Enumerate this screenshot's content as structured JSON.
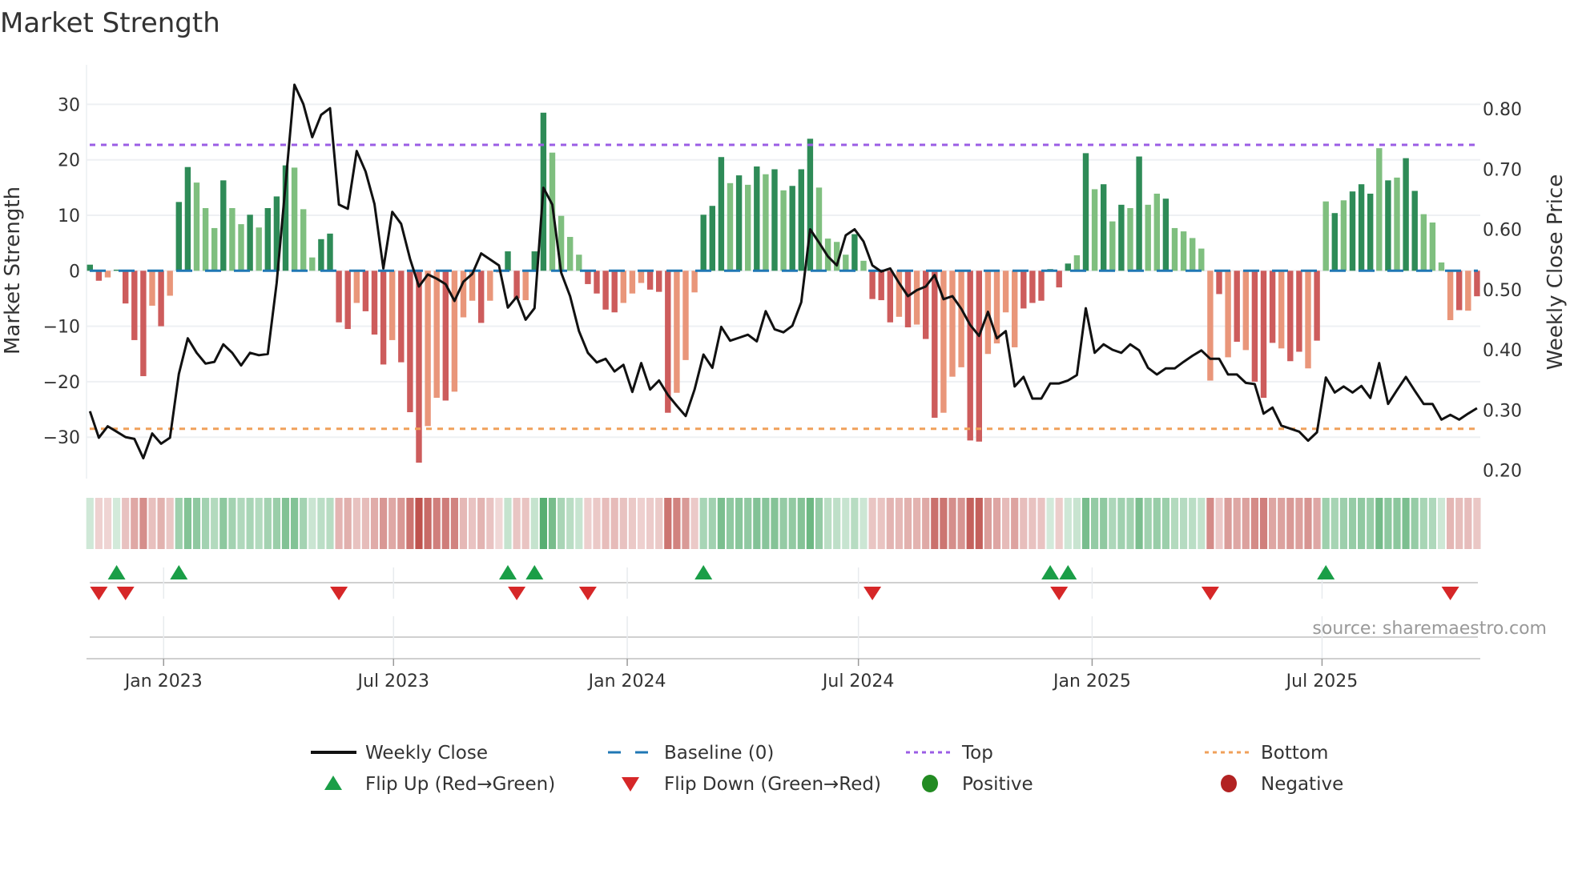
{
  "title": "Market Strength",
  "source": "source: sharemaestro.com",
  "colors": {
    "pos_strong": "#2e8b57",
    "pos_weak": "#7fbf7f",
    "neg_strong": "#cd5c5c",
    "neg_weak": "#e9967a",
    "heat_pos": "#3ca05a",
    "heat_neg": "#be504b",
    "close": "#111111",
    "baseline": "#1f77b4",
    "top": "#9b5de5",
    "bottom": "#f0a05a",
    "flip_up": "#1a9e47",
    "flip_down": "#d62728",
    "positive": "#228b22",
    "negative": "#b22222"
  },
  "chart_data": {
    "type": "bar",
    "title": "Market Strength",
    "ylabel": "Market Strength",
    "y2label": "Weekly Close Price",
    "ylim": [
      -37.5,
      37.1
    ],
    "y2lim": [
      0.186,
      0.873
    ],
    "yticks": [
      {
        "v": 30,
        "label": "30"
      },
      {
        "v": 20,
        "label": "20"
      },
      {
        "v": 10,
        "label": "10"
      },
      {
        "v": 0,
        "label": "0"
      },
      {
        "v": -10,
        "label": "−10"
      },
      {
        "v": -20,
        "label": "−20"
      },
      {
        "v": -30,
        "label": "−30"
      }
    ],
    "y2ticks": [
      {
        "v": 0.8,
        "label": "0.80"
      },
      {
        "v": 0.7,
        "label": "0.70"
      },
      {
        "v": 0.6,
        "label": "0.60"
      },
      {
        "v": 0.5,
        "label": "0.50"
      },
      {
        "v": 0.4,
        "label": "0.40"
      },
      {
        "v": 0.3,
        "label": "0.30"
      },
      {
        "v": 0.2,
        "label": "0.20"
      }
    ],
    "xticks": [
      {
        "date": "2023-01-01",
        "label": "Jan 2023"
      },
      {
        "date": "2023-07-01",
        "label": "Jul 2023"
      },
      {
        "date": "2024-01-01",
        "label": "Jan 2024"
      },
      {
        "date": "2024-07-01",
        "label": "Jul 2024"
      },
      {
        "date": "2025-01-01",
        "label": "Jan 2025"
      },
      {
        "date": "2025-07-01",
        "label": "Jul 2025"
      }
    ],
    "x_start": "2022-11-04",
    "x_freq": "weekly",
    "top_level": 22.7,
    "bottom_level": -28.5,
    "baseline": 0,
    "strength": [
      1.1,
      -1.8,
      -1.2,
      0.2,
      -5.9,
      -12.5,
      -19.0,
      -6.3,
      -10.0,
      -4.5,
      12.4,
      18.7,
      15.9,
      11.3,
      7.7,
      16.3,
      11.3,
      8.4,
      10.1,
      7.8,
      11.3,
      13.4,
      19.0,
      18.6,
      11.1,
      2.4,
      5.7,
      6.7,
      -9.3,
      -10.5,
      -5.8,
      -7.3,
      -11.5,
      -16.9,
      -12.5,
      -16.5,
      -25.5,
      -34.6,
      -28.0,
      -22.9,
      -23.4,
      -21.8,
      -8.4,
      -5.4,
      -9.4,
      -5.4,
      -0.3,
      3.5,
      -5.0,
      -5.3,
      3.5,
      28.5,
      21.3,
      9.9,
      6.1,
      2.9,
      -2.4,
      -4.1,
      -7.0,
      -7.5,
      -5.8,
      -4.1,
      -2.2,
      -3.4,
      -3.8,
      -25.6,
      -22.0,
      -16.1,
      -3.9,
      10.1,
      11.7,
      20.5,
      15.8,
      17.2,
      15.5,
      18.8,
      17.4,
      18.3,
      14.5,
      15.3,
      18.3,
      23.8,
      15.0,
      5.8,
      5.2,
      2.9,
      6.6,
      1.8,
      -5.1,
      -5.3,
      -9.3,
      -8.3,
      -10.2,
      -9.7,
      -12.3,
      -26.5,
      -25.6,
      -19.1,
      -17.4,
      -30.6,
      -30.8,
      -15.0,
      -13.1,
      -7.5,
      -13.8,
      -6.8,
      -5.8,
      -5.4,
      0.3,
      -3.0,
      1.3,
      2.8,
      21.2,
      14.7,
      15.6,
      8.9,
      11.9,
      11.3,
      20.6,
      11.9,
      13.9,
      13.0,
      7.7,
      7.1,
      5.9,
      4.0,
      -19.8,
      -4.2,
      -15.6,
      -12.8,
      -14.3,
      -20.0,
      -22.9,
      -13.0,
      -14.0,
      -16.3,
      -14.6,
      -17.6,
      -12.6,
      12.5,
      10.4,
      12.7,
      14.3,
      15.6,
      13.9,
      22.1,
      16.3,
      16.8,
      20.3,
      14.4,
      10.2,
      8.7,
      1.5,
      -8.9,
      -7.1,
      -7.2,
      -4.6
    ],
    "strength_shade": "ddlddddldlddllldlldldddllldddd ldddldddlldllldllddlddlllldddd llldddllldddldldldldddlllldldddldlddllld dllllddddddldldldldlldllllldldl dddlddldldldddldlddlllldldl",
    "close": [
      0.298,
      0.254,
      0.273,
      0.264,
      0.255,
      0.252,
      0.22,
      0.261,
      0.244,
      0.254,
      0.36,
      0.419,
      0.395,
      0.377,
      0.38,
      0.409,
      0.395,
      0.374,
      0.395,
      0.391,
      0.393,
      0.511,
      0.675,
      0.84,
      0.808,
      0.753,
      0.79,
      0.801,
      0.641,
      0.634,
      0.73,
      0.696,
      0.642,
      0.535,
      0.629,
      0.609,
      0.551,
      0.505,
      0.525,
      0.518,
      0.509,
      0.481,
      0.513,
      0.526,
      0.56,
      0.55,
      0.54,
      0.47,
      0.488,
      0.45,
      0.469,
      0.669,
      0.641,
      0.528,
      0.489,
      0.431,
      0.395,
      0.379,
      0.385,
      0.364,
      0.375,
      0.33,
      0.378,
      0.334,
      0.349,
      0.325,
      0.307,
      0.29,
      0.334,
      0.392,
      0.37,
      0.438,
      0.415,
      0.42,
      0.425,
      0.414,
      0.464,
      0.434,
      0.429,
      0.44,
      0.479,
      0.6,
      0.578,
      0.555,
      0.54,
      0.59,
      0.6,
      0.58,
      0.54,
      0.53,
      0.535,
      0.511,
      0.489,
      0.499,
      0.505,
      0.524,
      0.484,
      0.489,
      0.468,
      0.441,
      0.423,
      0.463,
      0.419,
      0.431,
      0.339,
      0.355,
      0.319,
      0.319,
      0.344,
      0.344,
      0.349,
      0.358,
      0.469,
      0.395,
      0.409,
      0.4,
      0.395,
      0.409,
      0.399,
      0.37,
      0.359,
      0.369,
      0.369,
      0.38,
      0.39,
      0.399,
      0.385,
      0.385,
      0.359,
      0.359,
      0.345,
      0.343,
      0.294,
      0.304,
      0.274,
      0.269,
      0.264,
      0.249,
      0.263,
      0.354,
      0.329,
      0.339,
      0.329,
      0.34,
      0.32,
      0.378,
      0.31,
      0.333,
      0.355,
      0.332,
      0.31,
      0.31,
      0.284,
      0.292,
      0.284,
      0.294,
      0.303
    ],
    "legend": [
      {
        "key": "close",
        "label": "Weekly Close",
        "symbol": "line"
      },
      {
        "key": "baseline",
        "label": "Baseline (0)",
        "symbol": "dash"
      },
      {
        "key": "top",
        "label": "Top",
        "symbol": "dot"
      },
      {
        "key": "bottom",
        "label": "Bottom",
        "symbol": "dot"
      },
      {
        "key": "flip_up",
        "label": "Flip Up (Red→Green)",
        "symbol": "tri-up"
      },
      {
        "key": "flip_down",
        "label": "Flip Down (Green→Red)",
        "symbol": "tri-down"
      },
      {
        "key": "positive",
        "label": "Positive",
        "symbol": "circle"
      },
      {
        "key": "negative",
        "label": "Negative",
        "symbol": "circle"
      }
    ],
    "legend_position": "bottom-center"
  }
}
